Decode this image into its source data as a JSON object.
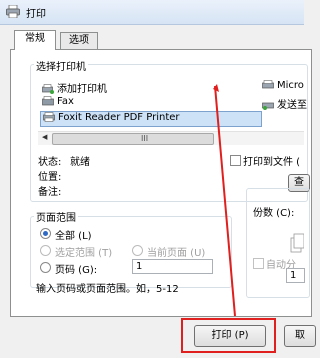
{
  "window": {
    "title": "打印"
  },
  "tabs": [
    {
      "label": "常规"
    },
    {
      "label": "选项"
    }
  ],
  "select_printer": {
    "heading": "选择打印机",
    "printers": [
      {
        "label": "添加打印机",
        "icon": "add-printer-icon"
      },
      {
        "label": "Fax",
        "icon": "fax-printer-icon"
      },
      {
        "label": "Foxit Reader PDF Printer",
        "icon": "printer-icon",
        "selected": true
      },
      {
        "label": "Micro",
        "icon": "printer-icon"
      },
      {
        "label": "发送至",
        "icon": "send-to-printer-icon"
      }
    ],
    "scroll_grip": "III"
  },
  "status": {
    "state_label": "状态:",
    "state_value": "就绪",
    "location_label": "位置:",
    "comment_label": "备注:"
  },
  "print_to_file": {
    "label": "打印到文件 ("
  },
  "find_button": {
    "label": "查"
  },
  "page_range": {
    "heading": "页面范围",
    "all": "全部 (L)",
    "selection": "选定范围 (T)",
    "current": "当前页面 (U)",
    "pages": "页码 (G):",
    "pages_value": "1",
    "hint": "输入页码或页面范围。如，5-12"
  },
  "copies": {
    "label": "份数 (C):",
    "collate": "自动分",
    "value": "1"
  },
  "buttons": {
    "print": "打印 (P)",
    "cancel": "取"
  },
  "colors": {
    "highlight": "#e0201e",
    "accent": "#2e6ac4"
  }
}
